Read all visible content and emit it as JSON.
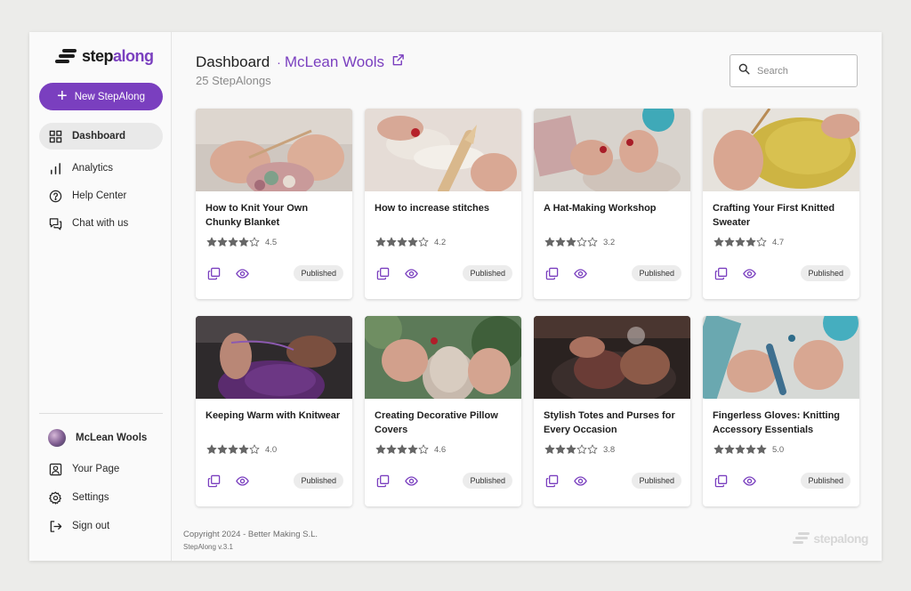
{
  "brand": {
    "name_a": "step",
    "name_b": "along",
    "accent": "#7a3fbf"
  },
  "sidebar": {
    "new_button": "New StepAlong",
    "items": [
      {
        "label": "Dashboard",
        "icon": "grid-icon"
      },
      {
        "label": "Analytics",
        "icon": "bar-chart-icon"
      },
      {
        "label": "Help Center",
        "icon": "help-circle-icon"
      },
      {
        "label": "Chat with us",
        "icon": "chat-icon"
      }
    ],
    "account": {
      "name": "McLean Wools",
      "items": [
        {
          "label": "Your Page",
          "icon": "user-page-icon"
        },
        {
          "label": "Settings",
          "icon": "gear-icon"
        },
        {
          "label": "Sign out",
          "icon": "sign-out-icon"
        }
      ]
    }
  },
  "header": {
    "title": "Dashboard",
    "separator": "·",
    "org": "McLean Wools",
    "count": "25 StepAlongs",
    "search_placeholder": "Search"
  },
  "cards": [
    {
      "title": "How to Knit Your Own Chunky Blanket",
      "rating": 4.5,
      "rating_text": "4.5",
      "status": "Published"
    },
    {
      "title": "How to increase stitches",
      "rating": 4.2,
      "rating_text": "4.2",
      "status": "Published"
    },
    {
      "title": "A Hat-Making Workshop",
      "rating": 3.2,
      "rating_text": "3.2",
      "status": "Published"
    },
    {
      "title": "Crafting Your First Knitted Sweater",
      "rating": 4.7,
      "rating_text": "4.7",
      "status": "Published"
    },
    {
      "title": "Keeping Warm with Knitwear",
      "rating": 4.0,
      "rating_text": "4.0",
      "status": "Published"
    },
    {
      "title": "Creating Decorative Pillow Covers",
      "rating": 4.6,
      "rating_text": "4.6",
      "status": "Published"
    },
    {
      "title": "Stylish Totes and Purses for Every Occasion",
      "rating": 3.8,
      "rating_text": "3.8",
      "status": "Published"
    },
    {
      "title": "Fingerless Gloves: Knitting Accessory Essentials",
      "rating": 5.0,
      "rating_text": "5.0",
      "status": "Published"
    }
  ],
  "footer": {
    "copyright": "Copyright 2024 - Better Making S.L.",
    "version": "StepAlong v.3.1"
  }
}
